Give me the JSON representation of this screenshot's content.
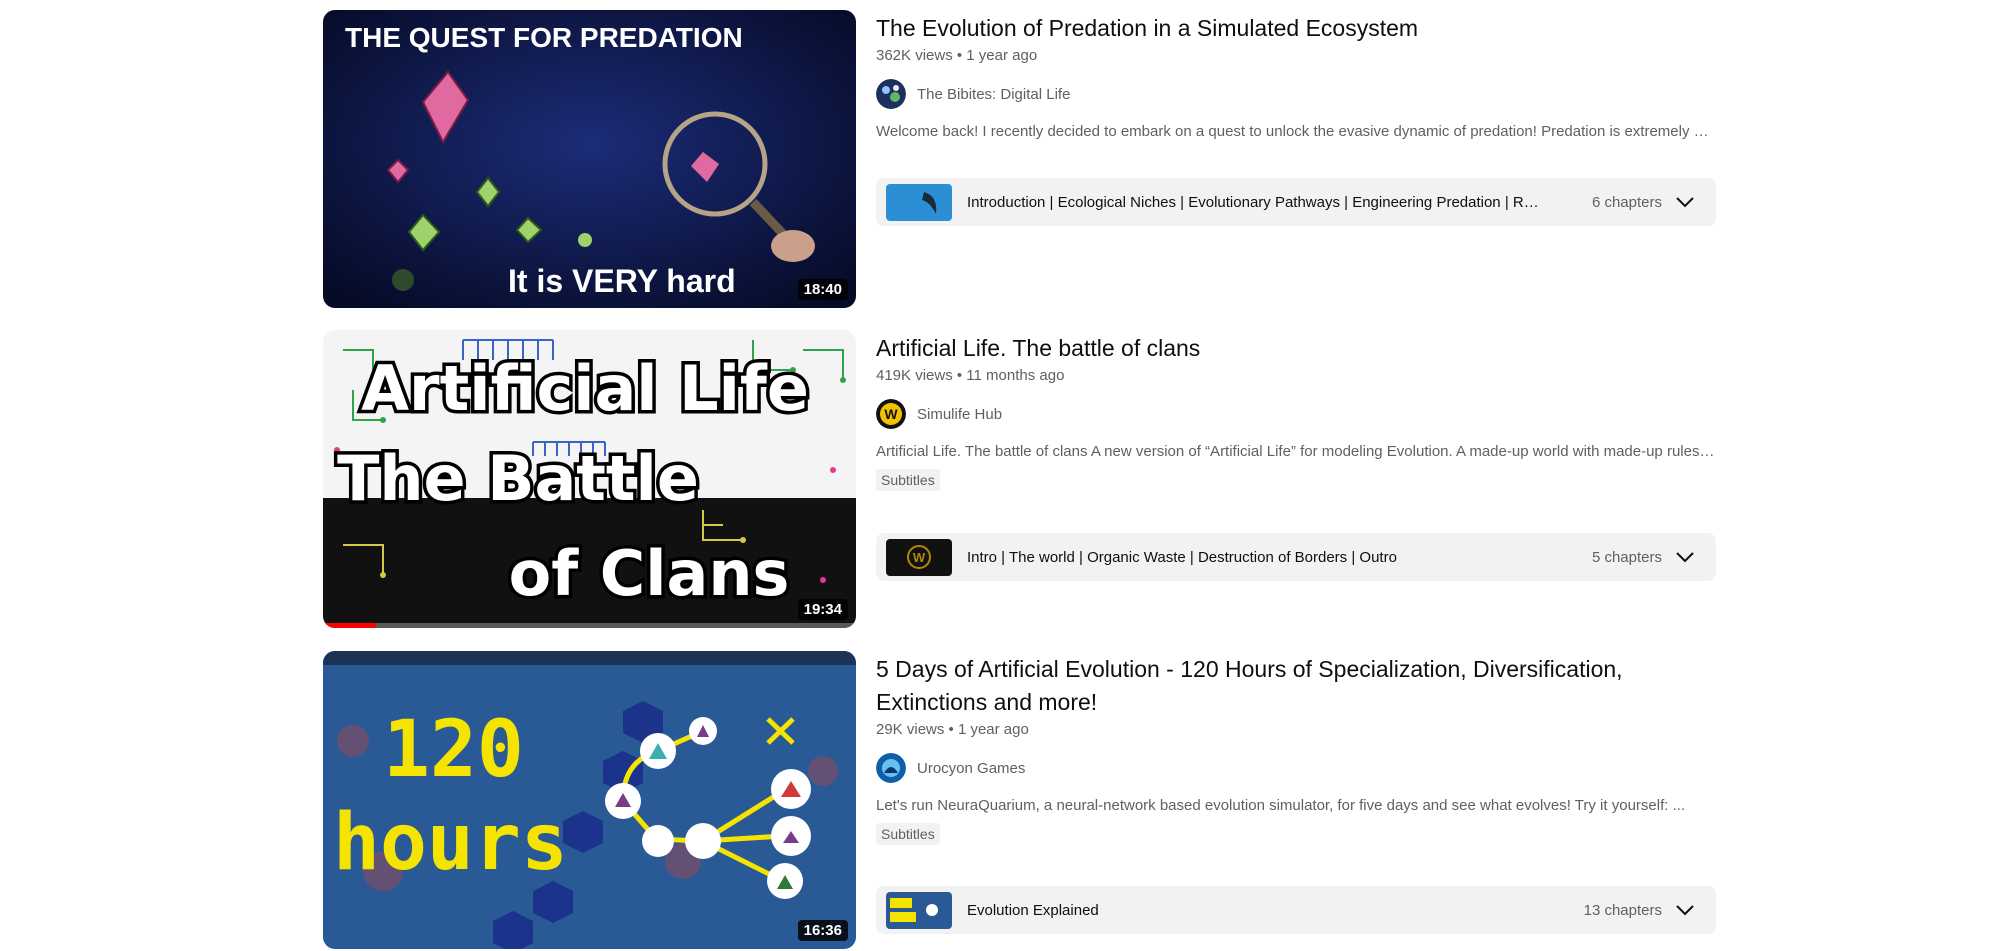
{
  "results": [
    {
      "title": "The Evolution of Predation in a Simulated Ecosystem",
      "meta": "362K views • 1 year ago",
      "channel": "The Bibites: Digital Life",
      "description": "Welcome back! I recently decided to embark on a quest to unlock the evasive dynamic of predation! Predation is extremely hard to achieve in this simulation, so I set out to find out why...",
      "chapters_text": "Introduction | Ecological Niches | Evolutionary Pathways | Engineering Predation | Results | Conclusion",
      "chapters_count": "6 chapters",
      "duration": "18:40",
      "thumb_top_text": "THE QUEST FOR PREDATION",
      "thumb_bottom_text": "It is VERY hard"
    },
    {
      "title": "Artificial Life. The battle of clans",
      "meta": "419K views • 11 months ago",
      "channel": "Simulife Hub",
      "description": "Artificial Life. The battle of clans A new version of “Artificial Life” for modeling Evolution. A made-up world with made-up rules where life evolves...",
      "badge": "Subtitles",
      "chapters_text": "Intro | The world | Organic Waste | Destruction of Borders | Outro",
      "chapters_count": "5 chapters",
      "duration": "19:34",
      "watched_fraction": 0.1,
      "thumb_line1": "Artificial Life",
      "thumb_line2": "The Battle",
      "thumb_line3": "of Clans",
      "avatar_letter": "W"
    },
    {
      "title": "5 Days of Artificial Evolution - 120 Hours of Specialization, Diversification, Extinctions and more!",
      "meta": "29K views • 1 year ago",
      "channel": "Urocyon Games",
      "description": "Let's run NeuraQuarium, a neural-network based evolution simulator, for five days and see what evolves! Try it yourself: ...",
      "badge": "Subtitles",
      "chapters_text": "Evolution Explained",
      "chapters_count": "13 chapters",
      "duration": "16:36",
      "thumb_line1": "120",
      "thumb_line2": "hours"
    }
  ],
  "colors": {
    "thumb1_bg": "#0a1540",
    "thumb3_bg": "#2a5a96",
    "accent_yellow": "#f5e400",
    "progress_red": "#ff0000"
  },
  "icons": [
    "chevron-down-icon"
  ]
}
